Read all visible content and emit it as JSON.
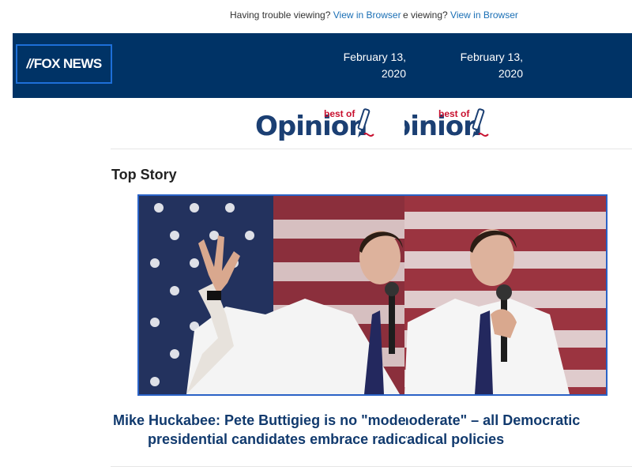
{
  "preheader": {
    "trouble_text": "Having trouble viewing?",
    "view_link": "View in Browser",
    "fragment_text": "e viewing?"
  },
  "header": {
    "brand": "FOX NEWS",
    "date": "February 13, 2020"
  },
  "opinion_logo": {
    "word": "Opinion",
    "bestof": "best of"
  },
  "top_story": {
    "section_title": "Top Story",
    "headline_line1": "Mike Huckabee: Pete Buttigieg is no \"moderate\" – all Democratic",
    "headline_line2": "presidential candidates embrace radical policies"
  },
  "colors": {
    "header_bg": "#003366",
    "link": "#1a6fb5",
    "headline": "#113a6e",
    "photo_border": "#2a62c6",
    "bestof": "#c8102e"
  }
}
